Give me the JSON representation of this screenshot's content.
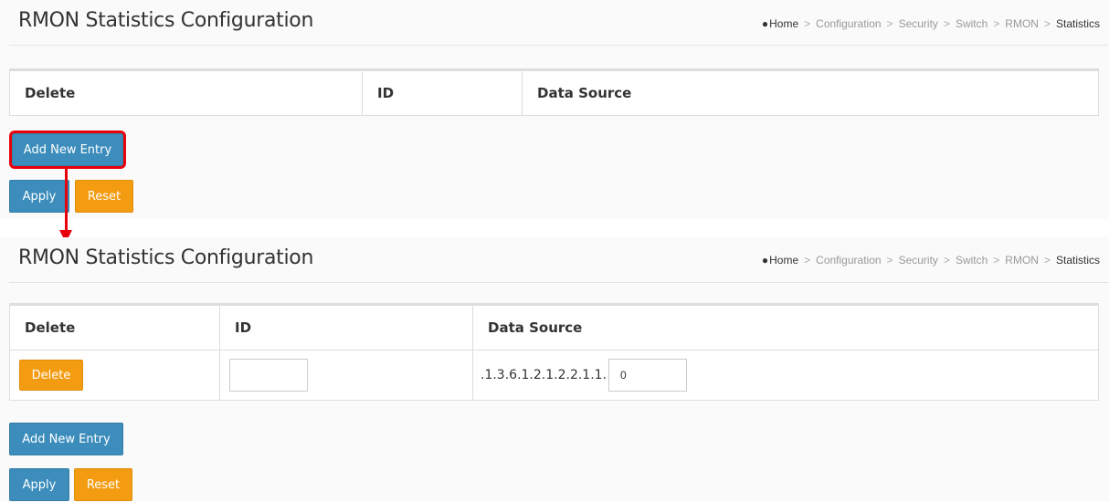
{
  "breadcrumb": {
    "home": "Home",
    "items": [
      "Configuration",
      "Security",
      "Switch",
      "RMON"
    ],
    "current": "Statistics",
    "separator": ">"
  },
  "top_panel": {
    "title": "RMON Statistics Configuration",
    "columns": [
      "Delete",
      "ID",
      "Data Source"
    ],
    "add_button": "Add New Entry",
    "apply_button": "Apply",
    "reset_button": "Reset"
  },
  "bottom_panel": {
    "title": "RMON Statistics Configuration",
    "columns": [
      "Delete",
      "ID",
      "Data Source"
    ],
    "row": {
      "delete_button": "Delete",
      "id_value": "",
      "data_source_prefix": ".1.3.6.1.2.1.2.2.1.1.",
      "data_source_value": "0"
    },
    "add_button": "Add New Entry",
    "apply_button": "Apply",
    "reset_button": "Reset"
  },
  "colors": {
    "primary": "#3c8dbc",
    "warning": "#f39c12",
    "highlight": "#e8000b"
  }
}
